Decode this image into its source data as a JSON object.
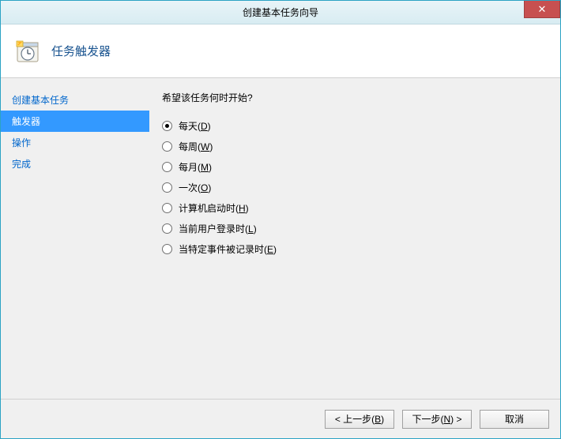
{
  "window": {
    "title": "创建基本任务向导",
    "close_symbol": "✕"
  },
  "header": {
    "title": "任务触发器"
  },
  "sidebar": {
    "items": [
      {
        "label": "创建基本任务",
        "active": false
      },
      {
        "label": "触发器",
        "active": true
      },
      {
        "label": "操作",
        "active": false
      },
      {
        "label": "完成",
        "active": false
      }
    ]
  },
  "main": {
    "question": "希望该任务何时开始?",
    "options": [
      {
        "prefix": "每天(",
        "hotkey": "D",
        "suffix": ")",
        "checked": true
      },
      {
        "prefix": "每周(",
        "hotkey": "W",
        "suffix": ")",
        "checked": false
      },
      {
        "prefix": "每月(",
        "hotkey": "M",
        "suffix": ")",
        "checked": false
      },
      {
        "prefix": "一次(",
        "hotkey": "O",
        "suffix": ")",
        "checked": false
      },
      {
        "prefix": "计算机启动时(",
        "hotkey": "H",
        "suffix": ")",
        "checked": false
      },
      {
        "prefix": "当前用户登录时(",
        "hotkey": "L",
        "suffix": ")",
        "checked": false
      },
      {
        "prefix": "当特定事件被记录时(",
        "hotkey": "E",
        "suffix": ")",
        "checked": false
      }
    ]
  },
  "footer": {
    "back": {
      "prefix": "< 上一步(",
      "hotkey": "B",
      "suffix": ")"
    },
    "next": {
      "prefix": "下一步(",
      "hotkey": "N",
      "suffix": ") >"
    },
    "cancel": {
      "label": "取消"
    }
  }
}
